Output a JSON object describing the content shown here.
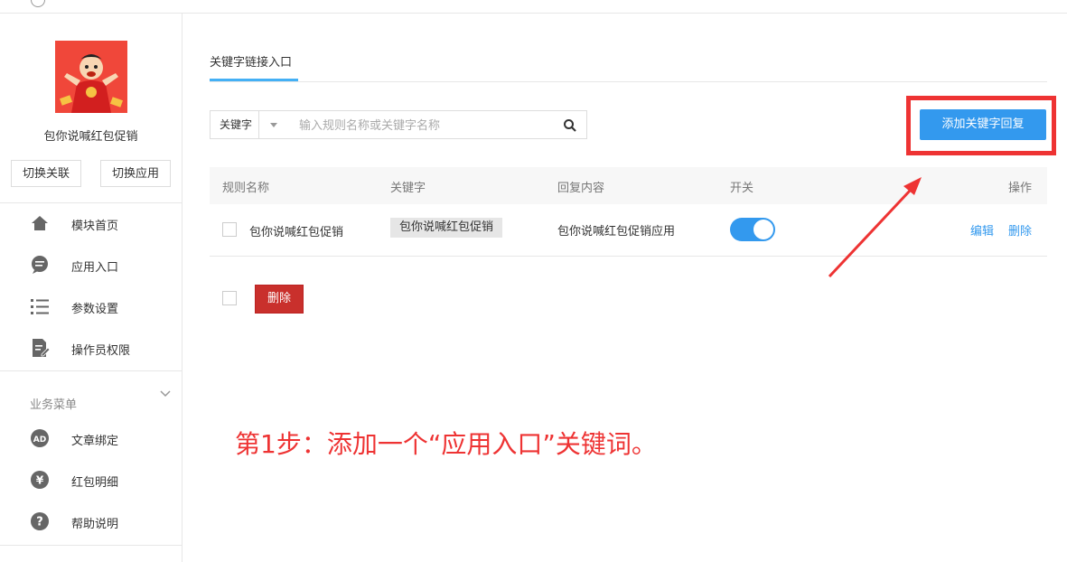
{
  "sidebar": {
    "app_name": "包你说喊红包促销",
    "buttons": [
      "切换关联",
      "切换应用"
    ],
    "menu": [
      {
        "label": "模块首页",
        "icon": "home-icon"
      },
      {
        "label": "应用入口",
        "icon": "chat-icon"
      },
      {
        "label": "参数设置",
        "icon": "list-icon"
      },
      {
        "label": "操作员权限",
        "icon": "edit-doc-icon"
      }
    ],
    "group_title": "业务菜单",
    "business_menu": [
      {
        "label": "文章绑定",
        "icon": "ad-icon"
      },
      {
        "label": "红包明细",
        "icon": "yen-icon"
      },
      {
        "label": "帮助说明",
        "icon": "question-icon"
      }
    ]
  },
  "main": {
    "tab": "关键字链接入口",
    "search": {
      "select_value": "关键字",
      "placeholder": "输入规则名称或关键字名称"
    },
    "add_button": "添加关键字回复",
    "table": {
      "headers": [
        "规则名称",
        "关键字",
        "回复内容",
        "开关",
        "操作"
      ],
      "rows": [
        {
          "name": "包你说喊红包促销",
          "keyword": "包你说喊红包促销",
          "reply": "包你说喊红包促销应用",
          "switch_on": true,
          "actions": [
            "编辑",
            "删除"
          ]
        }
      ]
    },
    "delete_button": "删除"
  },
  "annotation": "第1步：添加一个“应用入口”关键词。",
  "colors": {
    "accent": "#3399ee",
    "danger": "#c9302c",
    "annotation_red": "#ee3333"
  }
}
